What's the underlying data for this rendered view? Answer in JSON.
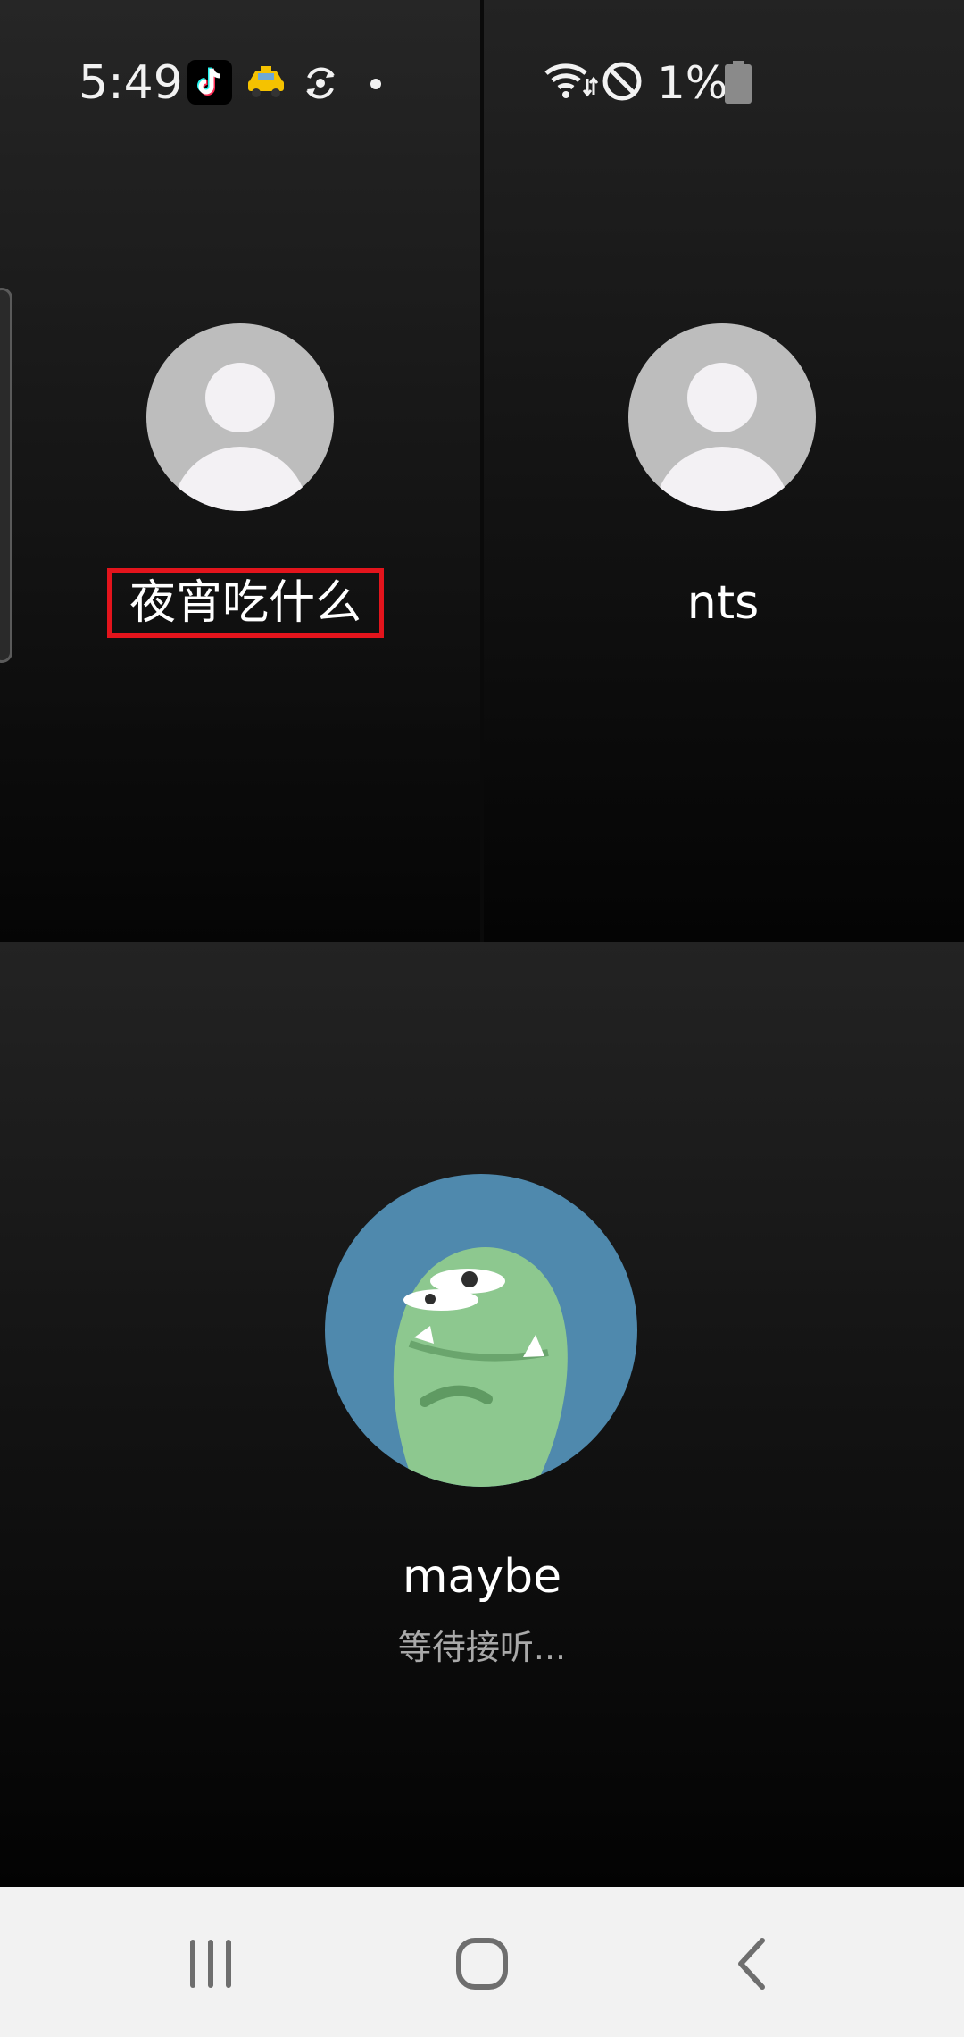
{
  "status_bar": {
    "time": "5:49",
    "battery_text": "1%",
    "icons": [
      "tiktok-icon",
      "taxi-icon",
      "sync-icon",
      "dot-icon",
      "wifi-icon",
      "do-not-disturb-icon",
      "battery-icon"
    ]
  },
  "participants": [
    {
      "name": "夜宵吃什么",
      "avatar": "default-avatar-icon",
      "highlighted": true
    },
    {
      "name": "nts",
      "avatar": "default-avatar-icon",
      "highlighted": false
    },
    {
      "name": "maybe",
      "avatar": "green-character-avatar",
      "status": "等待接听..."
    }
  ],
  "nav": {
    "buttons": [
      "recent-apps-icon",
      "home-icon",
      "back-icon"
    ]
  },
  "colors": {
    "highlight_border": "#e3141c",
    "avatar_bg": "#4f89ad",
    "nav_bg": "#f2f2f2"
  }
}
